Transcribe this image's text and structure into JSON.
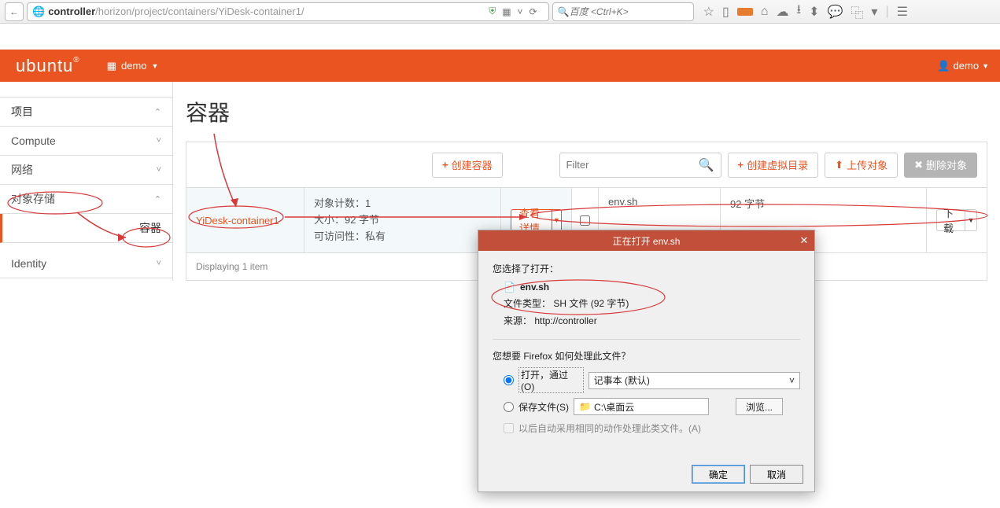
{
  "browser": {
    "url_bold": "controller",
    "url_rest": "/horizon/project/containers/YiDesk-container1/",
    "search_placeholder": "百度 <Ctrl+K>"
  },
  "header": {
    "logo": "ubuntu",
    "project_dd": "demo",
    "user_dd": "demo"
  },
  "sidebar": {
    "project": "项目",
    "compute": "Compute",
    "network": "网络",
    "object_storage": "对象存储",
    "container": "容器",
    "identity": "Identity"
  },
  "page": {
    "title": "容器",
    "btn_create_container": "创建容器",
    "filter_placeholder": "Filter",
    "btn_create_vdir": "创建虚拟目录",
    "btn_upload": "上传对象",
    "btn_delete": "删除对象"
  },
  "container": {
    "name": "YiDesk-container1",
    "meta_count_label": "对象计数：",
    "meta_count": "1",
    "meta_size_label": "大小：",
    "meta_size": "92 字节",
    "meta_access_label": "可访问性：",
    "meta_access": "私有",
    "btn_detail": "查看详情"
  },
  "object": {
    "name": "env.sh",
    "size": "92 字节",
    "btn_download": "下载"
  },
  "footer": {
    "displaying": "Displaying 1 item"
  },
  "dialog": {
    "title": "正在打开 env.sh",
    "you_chose": "您选择了打开：",
    "filename": "env.sh",
    "filetype_label": "文件类型：",
    "filetype_value": "SH 文件 (92 字节)",
    "source_label": "来源：",
    "source_value": "http://controller",
    "question": "您想要 Firefox 如何处理此文件？",
    "open_with": "打开，通过(O)",
    "open_app": "记事本 (默认)",
    "save_file": "保存文件(S)",
    "save_path": "C:\\桌面云",
    "browse": "浏览...",
    "remember": "以后自动采用相同的动作处理此类文件。(A)",
    "ok": "确定",
    "cancel": "取消"
  }
}
